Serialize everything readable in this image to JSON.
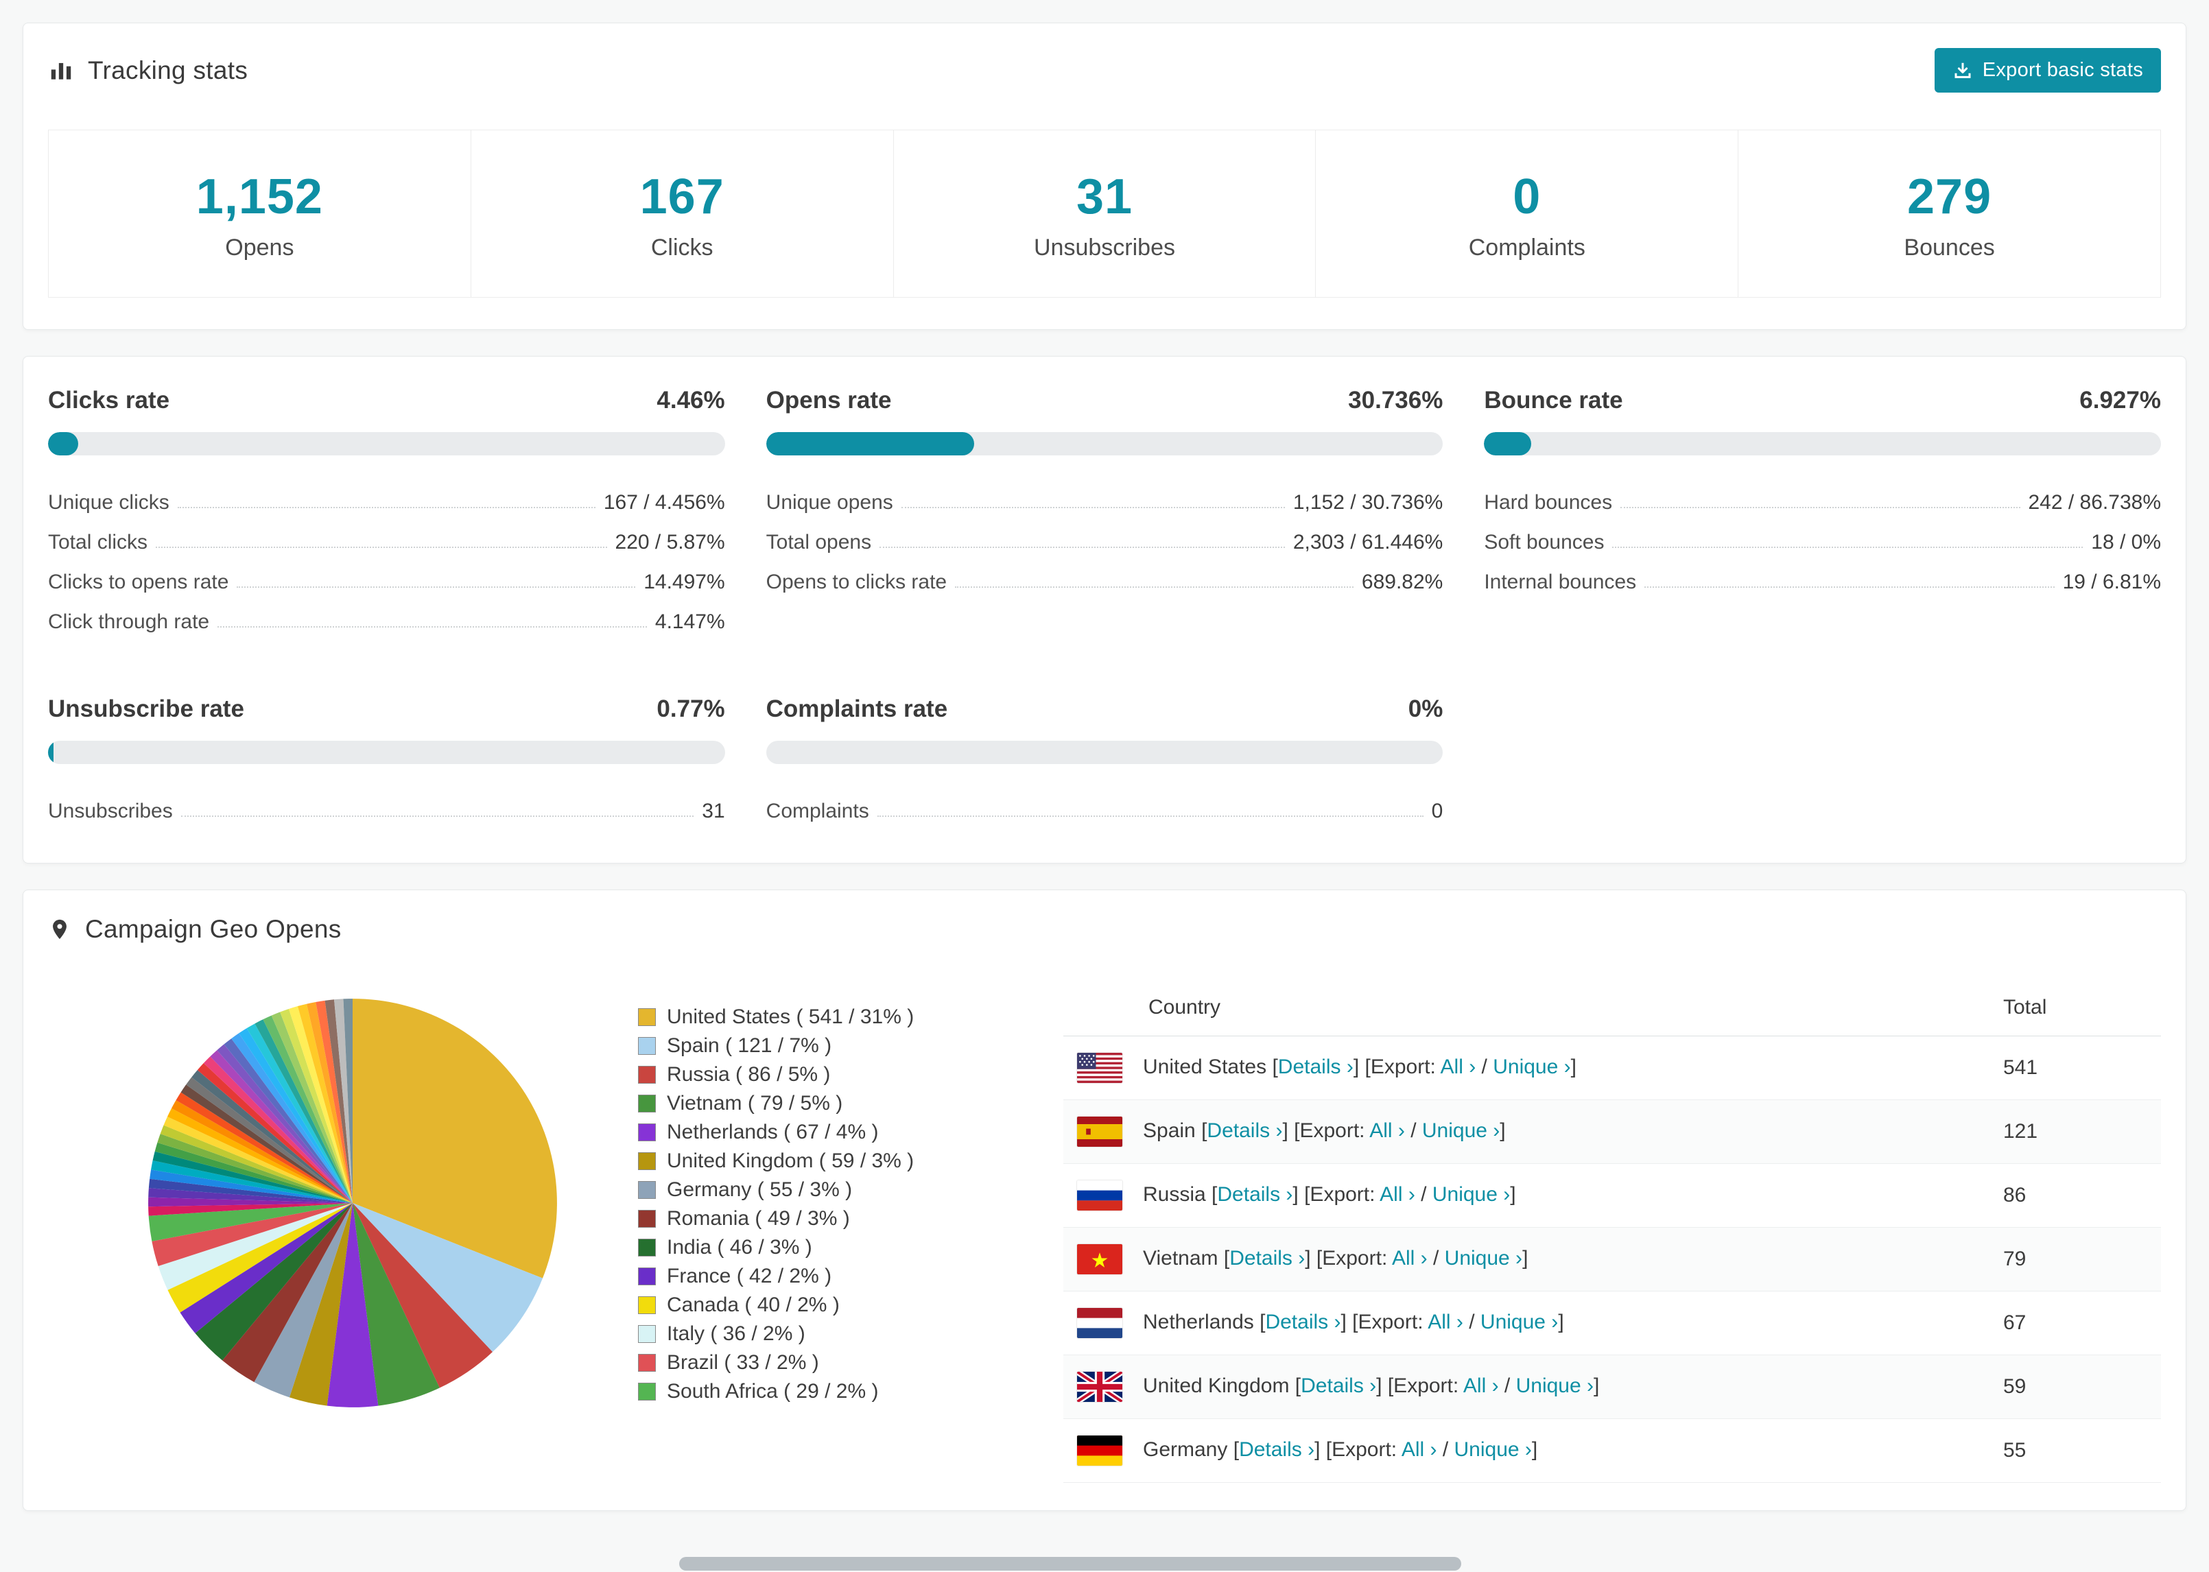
{
  "colors": {
    "accent": "#0e8fa4",
    "link": "#0e8fa4",
    "progress_track": "#e9ebed"
  },
  "icons": {
    "tracking_header": "bar-chart-icon",
    "export_button": "export-download-icon",
    "geo_header": "location-pin-icon"
  },
  "tracking": {
    "title": "Tracking stats",
    "export_button": "Export basic stats",
    "stats": [
      {
        "value": "1,152",
        "label": "Opens"
      },
      {
        "value": "167",
        "label": "Clicks"
      },
      {
        "value": "31",
        "label": "Unsubscribes"
      },
      {
        "value": "0",
        "label": "Complaints"
      },
      {
        "value": "279",
        "label": "Bounces"
      }
    ]
  },
  "rates": [
    {
      "title": "Clicks rate",
      "value": "4.46%",
      "percent": 4.46,
      "rows": [
        {
          "label": "Unique clicks",
          "value": "167 / 4.456%"
        },
        {
          "label": "Total clicks",
          "value": "220 / 5.87%"
        },
        {
          "label": "Clicks to opens rate",
          "value": "14.497%"
        },
        {
          "label": "Click through rate",
          "value": "4.147%"
        }
      ]
    },
    {
      "title": "Opens rate",
      "value": "30.736%",
      "percent": 30.736,
      "rows": [
        {
          "label": "Unique opens",
          "value": "1,152 / 30.736%"
        },
        {
          "label": "Total opens",
          "value": "2,303 / 61.446%"
        },
        {
          "label": "Opens to clicks rate",
          "value": "689.82%"
        }
      ]
    },
    {
      "title": "Bounce rate",
      "value": "6.927%",
      "percent": 6.927,
      "rows": [
        {
          "label": "Hard bounces",
          "value": "242 / 86.738%"
        },
        {
          "label": "Soft bounces",
          "value": "18 / 0%"
        },
        {
          "label": "Internal bounces",
          "value": "19 / 6.81%"
        }
      ]
    },
    {
      "title": "Unsubscribe rate",
      "value": "0.77%",
      "percent": 0.77,
      "rows": [
        {
          "label": "Unsubscribes",
          "value": "31"
        }
      ]
    },
    {
      "title": "Complaints rate",
      "value": "0%",
      "percent": 0,
      "rows": [
        {
          "label": "Complaints",
          "value": "0"
        }
      ]
    }
  ],
  "geo": {
    "title": "Campaign Geo Opens",
    "table": {
      "headers": [
        "Country",
        "Total"
      ],
      "lbracket": "[",
      "rbracket": "]",
      "details_label": "Details ›",
      "export_label": "Export:",
      "all_label": "All ›",
      "unique_label": "Unique ›",
      "separator": "/",
      "rows": [
        {
          "country": "United States",
          "total": "541",
          "flag": "us"
        },
        {
          "country": "Spain",
          "total": "121",
          "flag": "es"
        },
        {
          "country": "Russia",
          "total": "86",
          "flag": "ru"
        },
        {
          "country": "Vietnam",
          "total": "79",
          "flag": "vn"
        },
        {
          "country": "Netherlands",
          "total": "67",
          "flag": "nl"
        },
        {
          "country": "United Kingdom",
          "total": "59",
          "flag": "gb"
        },
        {
          "country": "Germany",
          "total": "55",
          "flag": "de",
          "partial": true
        }
      ]
    }
  },
  "chart_data": {
    "type": "pie",
    "title": "Campaign Geo Opens",
    "legend_position": "right",
    "slices": [
      {
        "label": "United States",
        "count": 541,
        "percent": 31,
        "color": "#e4b62e"
      },
      {
        "label": "Spain",
        "count": 121,
        "percent": 7,
        "color": "#a9d2ee"
      },
      {
        "label": "Russia",
        "count": 86,
        "percent": 5,
        "color": "#c9453f"
      },
      {
        "label": "Vietnam",
        "count": 79,
        "percent": 5,
        "color": "#47963e"
      },
      {
        "label": "Netherlands",
        "count": 67,
        "percent": 4,
        "color": "#8633d6"
      },
      {
        "label": "United Kingdom",
        "count": 59,
        "percent": 3,
        "color": "#b6960f"
      },
      {
        "label": "Germany",
        "count": 55,
        "percent": 3,
        "color": "#8ea3b8"
      },
      {
        "label": "Romania",
        "count": 49,
        "percent": 3,
        "color": "#93372f"
      },
      {
        "label": "India",
        "count": 46,
        "percent": 3,
        "color": "#25702f"
      },
      {
        "label": "France",
        "count": 42,
        "percent": 2,
        "color": "#6a2ec9"
      },
      {
        "label": "Canada",
        "count": 40,
        "percent": 2,
        "color": "#f2dc0c"
      },
      {
        "label": "Italy",
        "count": 36,
        "percent": 2,
        "color": "#d8f3f5"
      },
      {
        "label": "Brazil",
        "count": 33,
        "percent": 2,
        "color": "#e05156"
      },
      {
        "label": "South Africa",
        "count": 29,
        "percent": 2,
        "color": "#54b552"
      }
    ],
    "other_percent": 26,
    "other_colors": [
      "#d81b60",
      "#8e24aa",
      "#5e35b1",
      "#3949ab",
      "#1e88e5",
      "#00acc1",
      "#00897b",
      "#43a047",
      "#7cb342",
      "#c0ca33",
      "#fdd835",
      "#ffb300",
      "#fb8c00",
      "#f4511e",
      "#6d4c41",
      "#757575",
      "#546e7a",
      "#e53935",
      "#ec407a",
      "#ab47bc",
      "#7e57c2",
      "#5c6bc0",
      "#42a5f5",
      "#29b6f6",
      "#26c6da",
      "#26a69a",
      "#66bb6a",
      "#9ccc65",
      "#d4e157",
      "#ffee58",
      "#ffca28",
      "#ffa726",
      "#ff7043",
      "#8d6e63",
      "#bdbdbd",
      "#78909c"
    ]
  }
}
